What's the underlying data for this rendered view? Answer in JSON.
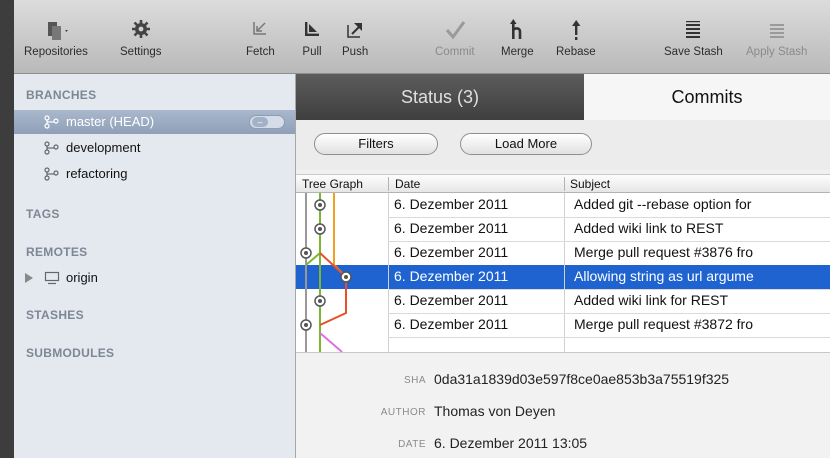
{
  "toolbar": {
    "repositories": "Repositories",
    "settings": "Settings",
    "fetch": "Fetch",
    "pull": "Pull",
    "push": "Push",
    "commit": "Commit",
    "merge": "Merge",
    "rebase": "Rebase",
    "save_stash": "Save Stash",
    "apply_stash": "Apply Stash"
  },
  "sidebar": {
    "branches_header": "BRANCHES",
    "branches": [
      {
        "label": "master (HEAD)",
        "selected": true
      },
      {
        "label": "development"
      },
      {
        "label": "refactoring"
      }
    ],
    "tags_header": "TAGS",
    "remotes_header": "REMOTES",
    "remotes": [
      {
        "label": "origin"
      }
    ],
    "stashes_header": "STASHES",
    "submodules_header": "SUBMODULES"
  },
  "tabs": {
    "status": "Status (3)",
    "commits": "Commits"
  },
  "filters": {
    "filters_button": "Filters",
    "load_more_button": "Load More"
  },
  "table": {
    "columns": [
      "Tree Graph",
      "Date",
      "Subject"
    ],
    "rows": [
      {
        "date": "6. Dezember 2011",
        "subject": "Added git --rebase option for"
      },
      {
        "date": "6. Dezember 2011",
        "subject": "Added wiki link to REST"
      },
      {
        "date": "6. Dezember 2011",
        "subject": "Merge pull request #3876 fro"
      },
      {
        "date": "6. Dezember 2011",
        "subject": "Allowing string as url argume",
        "selected": true
      },
      {
        "date": "6. Dezember 2011",
        "subject": "Added wiki link for REST"
      },
      {
        "date": "6. Dezember 2011",
        "subject": "Merge pull request #3872 fro"
      }
    ]
  },
  "details": {
    "sha_label": "SHA",
    "sha_value": "0da31a1839d03e597f8ce0ae853b3a75519f325",
    "author_label": "AUTHOR",
    "author_value": "Thomas von Deyen",
    "date_label": "DATE",
    "date_value": "6. Dezember 2011 13:05"
  },
  "colors": {
    "selection_blue": "#1e63d0",
    "sidebar_bg": "#e4e9ef",
    "graph_orange": "#f0a020",
    "graph_green": "#7ab830",
    "graph_red": "#e8502a",
    "graph_pink": "#e070e0"
  }
}
